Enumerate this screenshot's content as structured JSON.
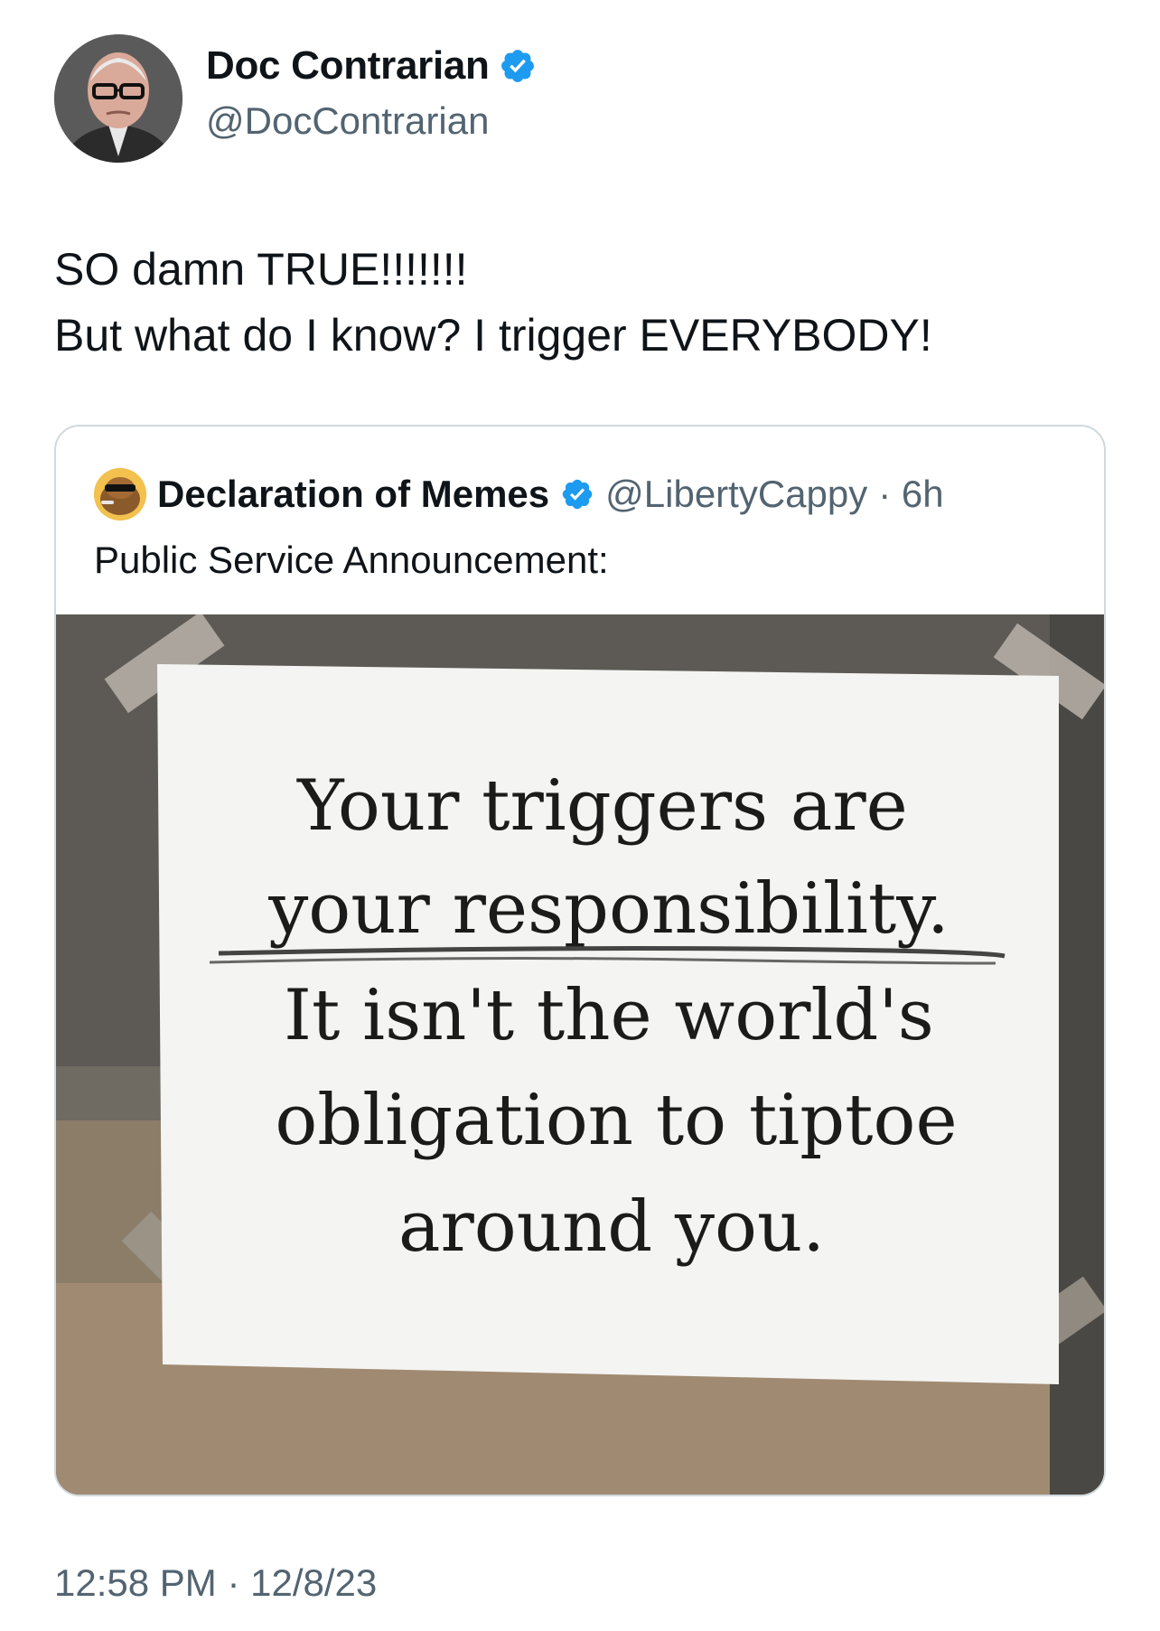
{
  "tweet": {
    "author": {
      "name": "Doc Contrarian",
      "handle": "@DocContrarian",
      "verified": true
    },
    "text_lines": [
      "SO damn TRUE!!!!!!!",
      "But what do I know? I trigger EVERYBODY!"
    ],
    "timestamp": "12:58 PM · 12/8/23"
  },
  "quote": {
    "author": {
      "name": "Declaration of Memes",
      "handle": "@LibertyCappy",
      "time": "· 6h",
      "verified": true
    },
    "text": "Public Service Announcement:",
    "sign_lines": [
      "Your triggers are",
      "your responsibility.",
      "It isn't the world's",
      "obligation to tiptoe",
      "around you."
    ]
  },
  "colors": {
    "verified": "#1d9bf0",
    "secondary_text": "#536471",
    "border": "#cfd9de"
  }
}
